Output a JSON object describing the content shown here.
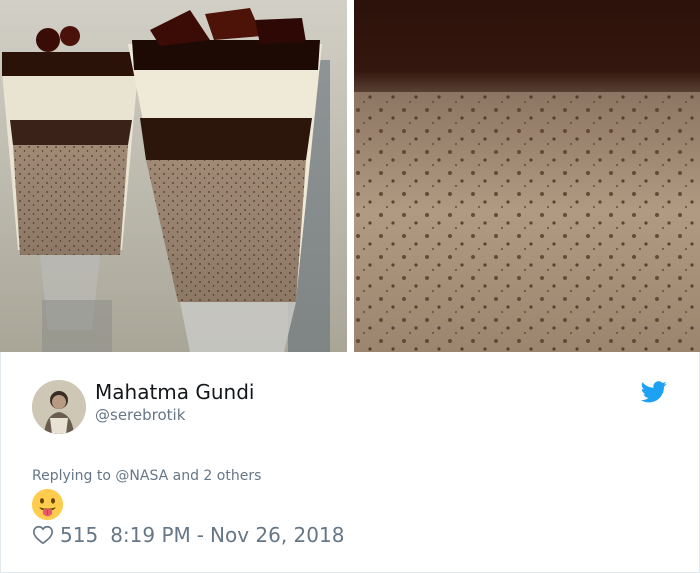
{
  "user": {
    "display_name": "Mahatma Gundi",
    "handle": "@serebrotik"
  },
  "tweet": {
    "reply_prefix": "Replying to",
    "reply_mention": "@NASA",
    "reply_suffix": "and 2 others",
    "emoji": "face-with-tongue",
    "likes": "515",
    "time": "8:19 PM",
    "separator": "-",
    "date": "Nov 26, 2018"
  },
  "colors": {
    "twitter_blue": "#1da1f2",
    "secondary_text": "#657786",
    "primary_text": "#14171a"
  },
  "images": {
    "left": "dessert-glasses-photo",
    "right": "dessert-closeup-photo"
  }
}
